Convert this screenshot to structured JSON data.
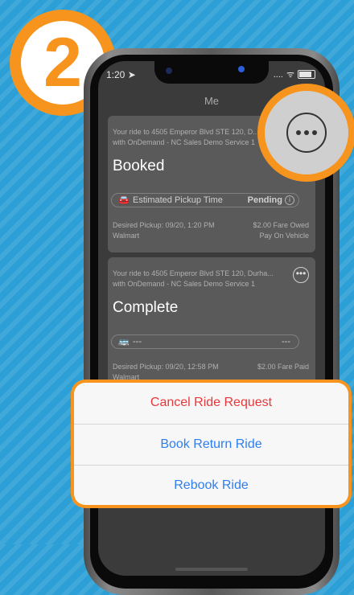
{
  "step": {
    "number": "2"
  },
  "status_bar": {
    "time": "1:20 ➤",
    "signal": "....",
    "wifi": "ᯤ"
  },
  "nav": {
    "title": "Me"
  },
  "rides": [
    {
      "description": "Your ride to 4505 Emperor Blvd STE 120, D... with OnDemand - NC Sales Demo Service 1",
      "status": "Booked",
      "pill": {
        "icon": "car-clock-icon",
        "label": "Estimated Pickup Time",
        "value": "Pending",
        "info": "i"
      },
      "desired_pickup": "Desired Pickup: 09/20, 1:20 PM",
      "location": "Walmart",
      "fare": "$2.00 Fare Owed",
      "payment": "Pay On Vehicle"
    },
    {
      "description": "Your ride to 4505 Emperor Blvd STE 120, Durha... with OnDemand - NC Sales Demo Service 1",
      "status": "Complete",
      "pill": {
        "icon": "bus-icon",
        "label": "---",
        "value": "---"
      },
      "desired_pickup": "Desired Pickup: 09/20, 12:58 PM",
      "location": "Walmart",
      "fare": "$2.00 Fare Paid"
    }
  ],
  "action_sheet": {
    "items": [
      {
        "label": "Cancel Ride Request",
        "style": "destructive"
      },
      {
        "label": "Book Return Ride",
        "style": "default"
      },
      {
        "label": "Rebook Ride",
        "style": "default"
      }
    ]
  },
  "colors": {
    "accent_orange": "#f7941d",
    "background_blue": "#2b9fd6",
    "ios_blue": "#2d7ff0",
    "destructive_red": "#e9383a"
  }
}
